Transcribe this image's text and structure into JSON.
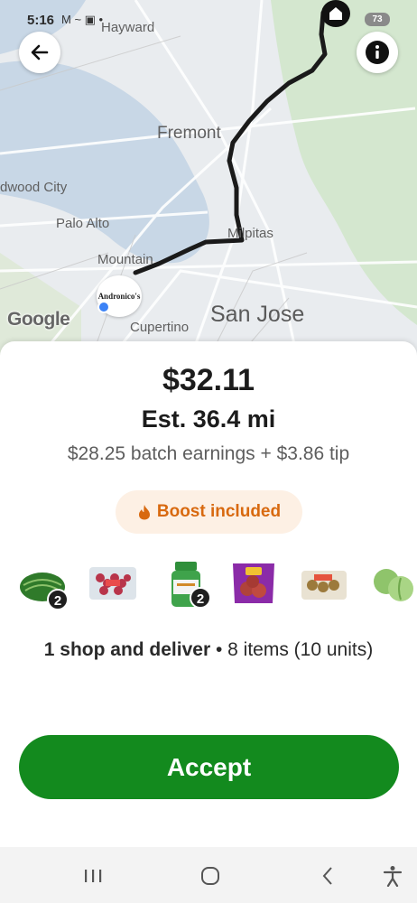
{
  "status_bar": {
    "time": "5:16",
    "icons": "M ~ ▣ •",
    "battery": "73"
  },
  "map": {
    "labels": {
      "hayward": "Hayward",
      "fremont": "Fremont",
      "redwood": "dwood City",
      "palo_alto": "Palo Alto",
      "mountain_view": "Mountain",
      "milpitas": "Milpitas",
      "san_jose": "San Jose",
      "cupertino": "Cupertino",
      "google": "Google",
      "store_logo": "Andronico's"
    },
    "route_color": "#1a1a1a"
  },
  "offer": {
    "amount": "$32.11",
    "distance": "Est. 36.4 mi",
    "breakdown": "$28.25 batch earnings + $3.86 tip",
    "boost_label": "Boost included",
    "items": [
      {
        "icon": "watermelon-icon",
        "qty": "2"
      },
      {
        "icon": "grapes-package-icon",
        "qty": ""
      },
      {
        "icon": "supplement-bottle-icon",
        "qty": "2"
      },
      {
        "icon": "potato-bag-icon",
        "qty": ""
      },
      {
        "icon": "produce-package-icon",
        "qty": ""
      },
      {
        "icon": "cabbage-icon",
        "qty": ""
      }
    ],
    "summary_bold": "1 shop and deliver",
    "summary_rest": " • 8 items (10 units)",
    "accept_label": "Accept"
  },
  "colors": {
    "accent_green": "#138a1e",
    "boost_orange": "#d8690f",
    "boost_bg": "#fdf0e4"
  }
}
